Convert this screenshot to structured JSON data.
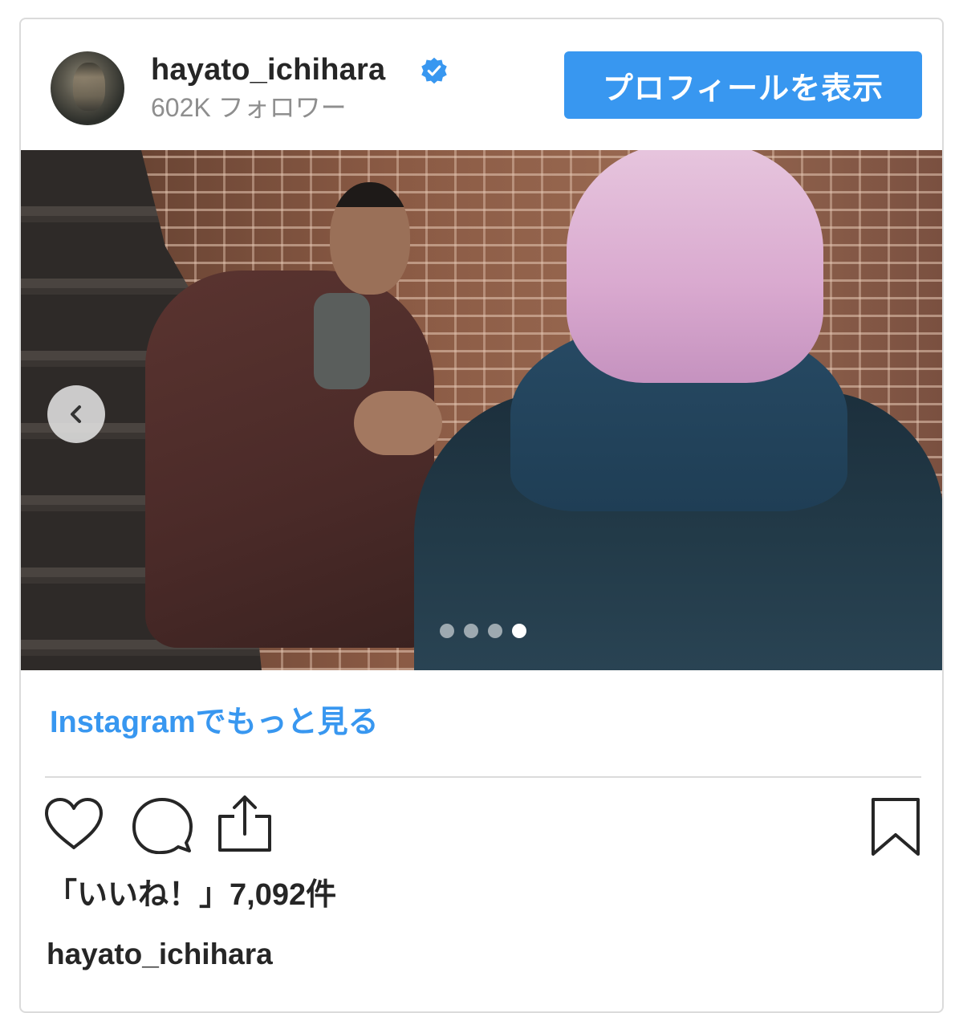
{
  "post": {
    "username": "hayato_ichihara",
    "followers": "602K フォロワー",
    "profile_button": "プロフィールを表示",
    "more_link": "Instagramでもっと見る",
    "likes_text": "「いいね！」7,092件",
    "caption_username": "hayato_ichihara",
    "carousel_active_index": 4,
    "carousel_total": 4
  },
  "icons": {
    "verified": "verified-badge-icon",
    "prev": "chevron-left-icon",
    "like": "heart-icon",
    "comment": "comment-icon",
    "share": "share-icon",
    "save": "bookmark-icon"
  },
  "colors": {
    "accent": "#3897f0",
    "text": "#262626",
    "muted": "#8e8e8e",
    "border": "#dbdbdb"
  }
}
